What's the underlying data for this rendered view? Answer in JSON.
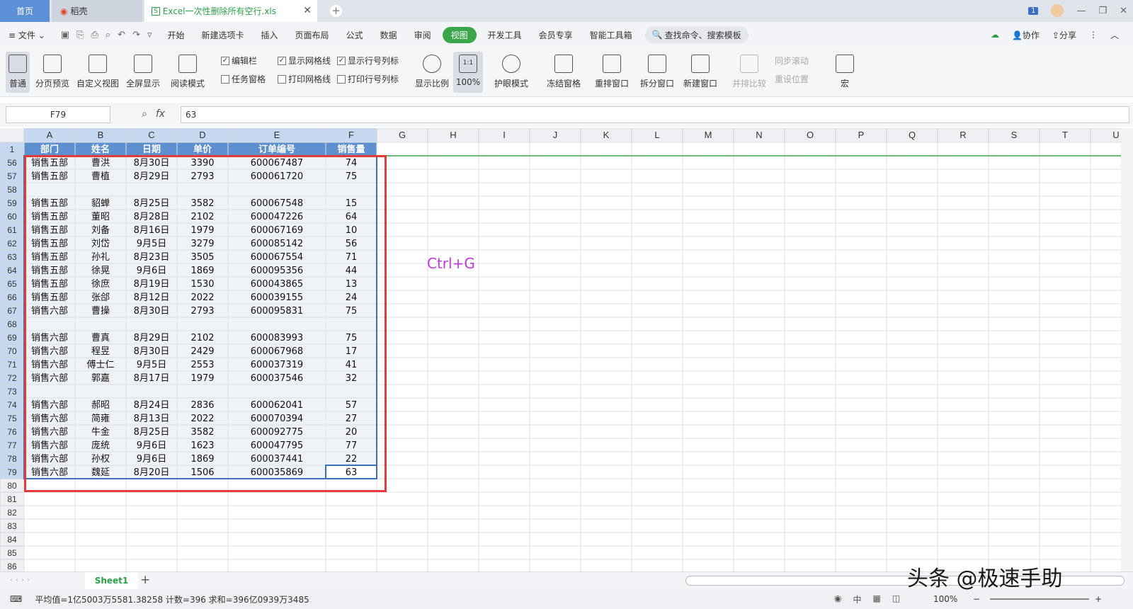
{
  "tabs": {
    "home": "首页",
    "daoke": "稻壳",
    "file": "Excel一次性删除所有空行.xls"
  },
  "window": {
    "badge": "1"
  },
  "menu": {
    "file": "文件",
    "items": [
      "开始",
      "新建选项卡",
      "插入",
      "页面布局",
      "公式",
      "数据",
      "审阅",
      "视图",
      "开发工具",
      "会员专享",
      "智能工具箱"
    ],
    "active_index": 7,
    "search": "查找命令、搜索模板",
    "right": [
      "协作",
      "分享"
    ]
  },
  "toolbar": {
    "buttons": [
      "普通",
      "分页预览",
      "自定义视图",
      "全屏显示",
      "阅读模式"
    ],
    "checks_top": [
      {
        "label": "编辑栏",
        "checked": true
      },
      {
        "label": "显示网格线",
        "checked": true
      },
      {
        "label": "显示行号列标",
        "checked": true
      }
    ],
    "checks_bottom": [
      {
        "label": "任务窗格",
        "checked": false
      },
      {
        "label": "打印网格线",
        "checked": false
      },
      {
        "label": "打印行号列标",
        "checked": false
      }
    ],
    "zoom_btn": "显示比例",
    "zoom100": "100%",
    "zoom100_icon": "1:1",
    "eye": "护眼模式",
    "buttons2": [
      "冻结窗格",
      "重排窗口",
      "拆分窗口",
      "新建窗口"
    ],
    "disabled": [
      "并排比较",
      "同步滚动",
      "重设位置"
    ],
    "macro": "宏"
  },
  "formula": {
    "namebox": "F79",
    "value": "63",
    "fx": "fx"
  },
  "columns": [
    "A",
    "B",
    "C",
    "D",
    "E",
    "F",
    "G",
    "H",
    "I",
    "J",
    "K",
    "L",
    "M",
    "N",
    "O",
    "P",
    "Q",
    "R",
    "S",
    "T",
    "U"
  ],
  "header": [
    "部门",
    "姓名",
    "日期",
    "单价",
    "订单编号",
    "销售量"
  ],
  "rows": [
    {
      "n": "56",
      "c": [
        "销售五部",
        "曹洪",
        "8月30日",
        "3390",
        "600067487",
        "74"
      ]
    },
    {
      "n": "57",
      "c": [
        "销售五部",
        "曹植",
        "8月29日",
        "2793",
        "600061720",
        "75"
      ]
    },
    {
      "n": "58",
      "c": [
        "",
        "",
        "",
        "",
        "",
        ""
      ]
    },
    {
      "n": "59",
      "c": [
        "销售五部",
        "貂蝉",
        "8月25日",
        "3582",
        "600067548",
        "15"
      ]
    },
    {
      "n": "60",
      "c": [
        "销售五部",
        "董昭",
        "8月28日",
        "2102",
        "600047226",
        "64"
      ]
    },
    {
      "n": "61",
      "c": [
        "销售五部",
        "刘备",
        "8月16日",
        "1979",
        "600067169",
        "10"
      ]
    },
    {
      "n": "62",
      "c": [
        "销售五部",
        "刘岱",
        "9月5日",
        "3279",
        "600085142",
        "56"
      ]
    },
    {
      "n": "63",
      "c": [
        "销售五部",
        "孙礼",
        "8月23日",
        "3505",
        "600067554",
        "71"
      ]
    },
    {
      "n": "64",
      "c": [
        "销售五部",
        "徐晃",
        "9月6日",
        "1869",
        "600095356",
        "44"
      ]
    },
    {
      "n": "65",
      "c": [
        "销售五部",
        "徐庶",
        "8月19日",
        "1530",
        "600043865",
        "13"
      ]
    },
    {
      "n": "66",
      "c": [
        "销售五部",
        "张郃",
        "8月12日",
        "2022",
        "600039155",
        "24"
      ]
    },
    {
      "n": "67",
      "c": [
        "销售六部",
        "曹操",
        "8月30日",
        "2793",
        "600095831",
        "75"
      ]
    },
    {
      "n": "68",
      "c": [
        "",
        "",
        "",
        "",
        "",
        ""
      ]
    },
    {
      "n": "69",
      "c": [
        "销售六部",
        "曹真",
        "8月29日",
        "2102",
        "600083993",
        "75"
      ]
    },
    {
      "n": "70",
      "c": [
        "销售六部",
        "程昱",
        "8月30日",
        "2429",
        "600067968",
        "17"
      ]
    },
    {
      "n": "71",
      "c": [
        "销售六部",
        "傅士仁",
        "9月5日",
        "2553",
        "600037319",
        "41"
      ]
    },
    {
      "n": "72",
      "c": [
        "销售六部",
        "郭嘉",
        "8月17日",
        "1979",
        "600037546",
        "32"
      ]
    },
    {
      "n": "73",
      "c": [
        "",
        "",
        "",
        "",
        "",
        ""
      ]
    },
    {
      "n": "74",
      "c": [
        "销售六部",
        "郝昭",
        "8月24日",
        "2836",
        "600062041",
        "57"
      ]
    },
    {
      "n": "75",
      "c": [
        "销售六部",
        "简雍",
        "8月13日",
        "2022",
        "600070394",
        "27"
      ]
    },
    {
      "n": "76",
      "c": [
        "销售六部",
        "牛金",
        "8月25日",
        "3582",
        "600092775",
        "20"
      ]
    },
    {
      "n": "77",
      "c": [
        "销售六部",
        "庞统",
        "9月6日",
        "1623",
        "600047795",
        "77"
      ]
    },
    {
      "n": "78",
      "c": [
        "销售六部",
        "孙权",
        "9月6日",
        "1869",
        "600037441",
        "22"
      ]
    },
    {
      "n": "79",
      "c": [
        "销售六部",
        "魏延",
        "8月20日",
        "1506",
        "600035869",
        "63"
      ]
    }
  ],
  "empty_rows": [
    "80",
    "81",
    "82",
    "83",
    "84",
    "85",
    "86"
  ],
  "annotation": "Ctrl+G",
  "sheet": "Sheet1",
  "status": {
    "text": "平均值=1亿5003万5581.38258  计数=396  求和=396亿0939万3485",
    "zoom": "100%"
  },
  "watermark": "头条 @极速手助"
}
